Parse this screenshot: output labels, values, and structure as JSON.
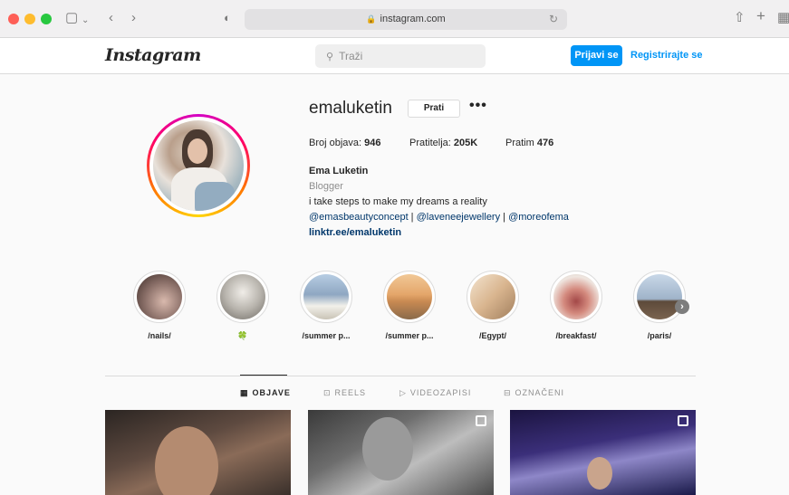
{
  "browser": {
    "url": "instagram.com"
  },
  "header": {
    "logo": "Instagram",
    "search_placeholder": "Traži",
    "login_label": "Prijavi se",
    "signup_label": "Registrirajte se"
  },
  "profile": {
    "username": "emaluketin",
    "follow_label": "Prati",
    "more_label": "•••",
    "posts_label": "Broj objava:",
    "posts_count": "946",
    "followers_label": "Pratitelja:",
    "followers_count": "205K",
    "following_label": "Pratim",
    "following_count": "476",
    "full_name": "Ema Luketin",
    "category": "Blogger",
    "bio": "i take steps to make my dreams a reality",
    "mentions": [
      "@emasbeautyconcept",
      "@laveneejewellery",
      "@moreofema"
    ],
    "mention_separator": " | ",
    "link": "linktr.ee/emaluketin"
  },
  "highlights": [
    {
      "label": "/nails/",
      "color": "#8a6f68"
    },
    {
      "label": "🍀",
      "color": "#c9c6c1"
    },
    {
      "label": "/summer p...",
      "color": "#8fa7c2"
    },
    {
      "label": "/summer p...",
      "color": "#d8a06a"
    },
    {
      "label": "/Egypt/",
      "color": "#d9b58f"
    },
    {
      "label": "/breakfast/",
      "color": "#c98a80"
    },
    {
      "label": "/paris/",
      "color": "#9fb3c9"
    }
  ],
  "tabs": [
    {
      "icon": "▦",
      "label": "OBJAVE",
      "active": true
    },
    {
      "icon": "⊡",
      "label": "REELS",
      "active": false
    },
    {
      "icon": "▷",
      "label": "VIDEOZAPISI",
      "active": false
    },
    {
      "icon": "⊟",
      "label": "OZNAČENI",
      "active": false
    }
  ],
  "colors": {
    "accent": "#0095f6",
    "link": "#00376b",
    "muted": "#8e8e8e"
  }
}
